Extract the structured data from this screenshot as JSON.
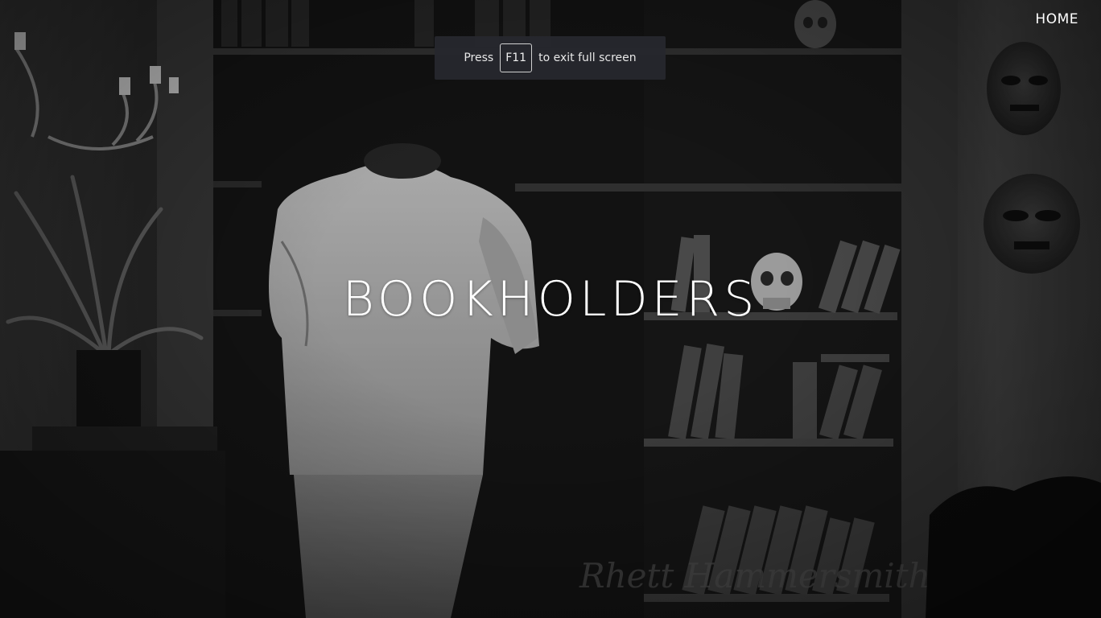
{
  "nav": {
    "home_label": "HOME"
  },
  "fullscreen_notice": {
    "prefix": "Press",
    "key": "F11",
    "suffix": "to exit full screen"
  },
  "hero": {
    "title": "BOOKHOLDERS",
    "background_description_icon": "black-and-white-library-scene"
  },
  "watermark": {
    "signature": "Rhett Hammersmith"
  },
  "colors": {
    "title_text": "#ffffff",
    "toast_background": "#26282e",
    "scene_dark": "#1b1b1b"
  }
}
